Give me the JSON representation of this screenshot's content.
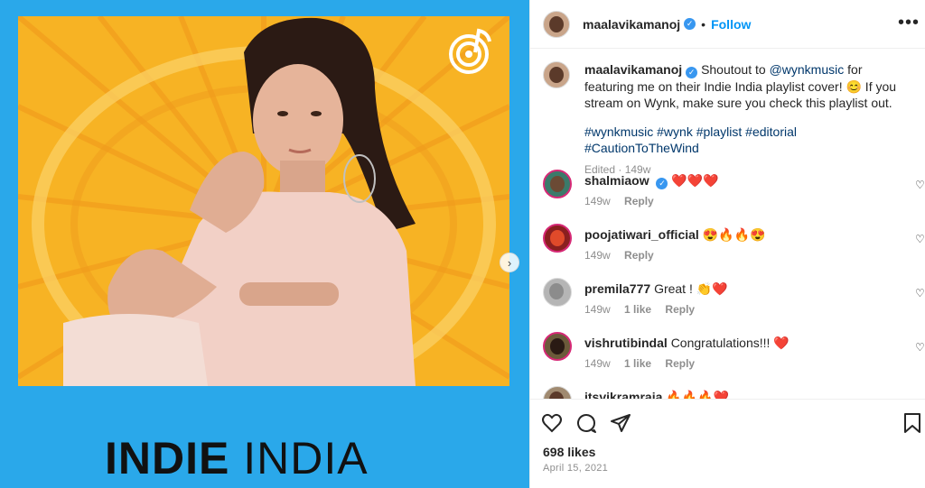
{
  "media": {
    "brand_bold": "INDIE",
    "brand_light": "INDIA"
  },
  "post": {
    "author": "maalavikamanoj",
    "follow_label": "Follow",
    "caption_pre": "Shoutout to ",
    "caption_mention": "@wynkmusic",
    "caption_post": " for featuring me on their Indie India playlist cover! 😊 If you stream on Wynk, make sure you check this playlist out.",
    "hashtags": "#wynkmusic #wynk #playlist #editorial #CautionToTheWind",
    "edited": "Edited · 149w"
  },
  "comments": [
    {
      "user": "shalmiaow",
      "verified": true,
      "text": "❤️❤️❤️",
      "time": "149w",
      "likes": "",
      "reply": "Reply"
    },
    {
      "user": "poojatiwari_official",
      "verified": false,
      "text": "😍🔥🔥😍",
      "time": "149w",
      "likes": "",
      "reply": "Reply"
    },
    {
      "user": "premila777",
      "verified": false,
      "text": "Great ! 👏❤️",
      "time": "149w",
      "likes": "1 like",
      "reply": "Reply"
    },
    {
      "user": "vishrutibindal",
      "verified": false,
      "text": "Congratulations!!! ❤️",
      "time": "149w",
      "likes": "1 like",
      "reply": "Reply"
    },
    {
      "user": "itsvikramraja",
      "verified": false,
      "text": "🔥🔥🔥❤️",
      "time": "",
      "likes": "",
      "reply": ""
    }
  ],
  "footer": {
    "likes": "698 likes",
    "date": "April 15, 2021"
  },
  "colors": {
    "blue_bg": "#2aa8ea",
    "art_yellow": "#f7b324",
    "link": "#0095f6"
  },
  "icons": [
    "heart-icon",
    "comment-icon",
    "share-icon",
    "save-icon",
    "more-icon",
    "verified-icon",
    "chevron-right-icon",
    "wynk-logo-icon"
  ]
}
